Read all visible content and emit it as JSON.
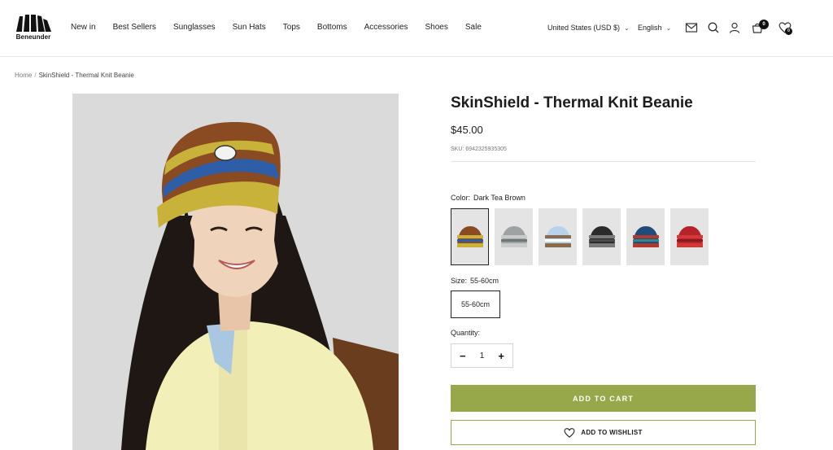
{
  "brand": {
    "name": "Beneunder"
  },
  "nav": {
    "items": [
      "New in",
      "Best Sellers",
      "Sunglasses",
      "Sun Hats",
      "Tops",
      "Bottoms",
      "Accessories",
      "Shoes",
      "Sale"
    ]
  },
  "header": {
    "currency": "United States (USD $)",
    "language": "English",
    "cart_count": "0",
    "wishlist_count": "0",
    "icons": [
      "mail-icon",
      "search-icon",
      "account-icon",
      "cart-icon",
      "wishlist-icon"
    ]
  },
  "breadcrumb": {
    "home": "Home",
    "separator": "/",
    "current": "SkinShield - Thermal Knit Beanie"
  },
  "product": {
    "title": "SkinShield - Thermal Knit Beanie",
    "price": "$45.00",
    "sku": "SKU: 6942325935305",
    "color_label": "Color:",
    "color_value": "Dark Tea Brown",
    "swatches": [
      {
        "name": "Dark Tea Brown",
        "main": "#8a4a22",
        "stripe1": "#c9b23a",
        "stripe2": "#2f5ea8",
        "selected": true
      },
      {
        "name": "Grey",
        "main": "#9ea2a3",
        "stripe1": "#c9cbcb",
        "stripe2": "#6f7677",
        "selected": false
      },
      {
        "name": "Light Blue",
        "main": "#b7d2ea",
        "stripe1": "#8a6a4a",
        "stripe2": "#ffffff",
        "selected": false
      },
      {
        "name": "Black",
        "main": "#2b2b2b",
        "stripe1": "#7a7a7a",
        "stripe2": "#4a4a4a",
        "selected": false
      },
      {
        "name": "Navy Multi",
        "main": "#1f4c7a",
        "stripe1": "#b03a2e",
        "stripe2": "#2f8a8a",
        "selected": false
      },
      {
        "name": "Red",
        "main": "#b8232a",
        "stripe1": "#d23a3a",
        "stripe2": "#8e1a20",
        "selected": false
      }
    ],
    "size_label": "Size:",
    "size_value": "55-60cm",
    "size_option": "55-60cm",
    "quantity_label": "Quantity:",
    "quantity": "1",
    "minus": "−",
    "plus": "+",
    "add_to_cart": "ADD TO CART",
    "add_to_wishlist": "ADD TO WISHLIST"
  },
  "colors": {
    "accent": "#96a84a",
    "image_bg": "#d9d9d9",
    "hat_brown": "#8a4a22",
    "hat_yellow": "#c9b23a",
    "hat_blue": "#2f5ea8"
  }
}
